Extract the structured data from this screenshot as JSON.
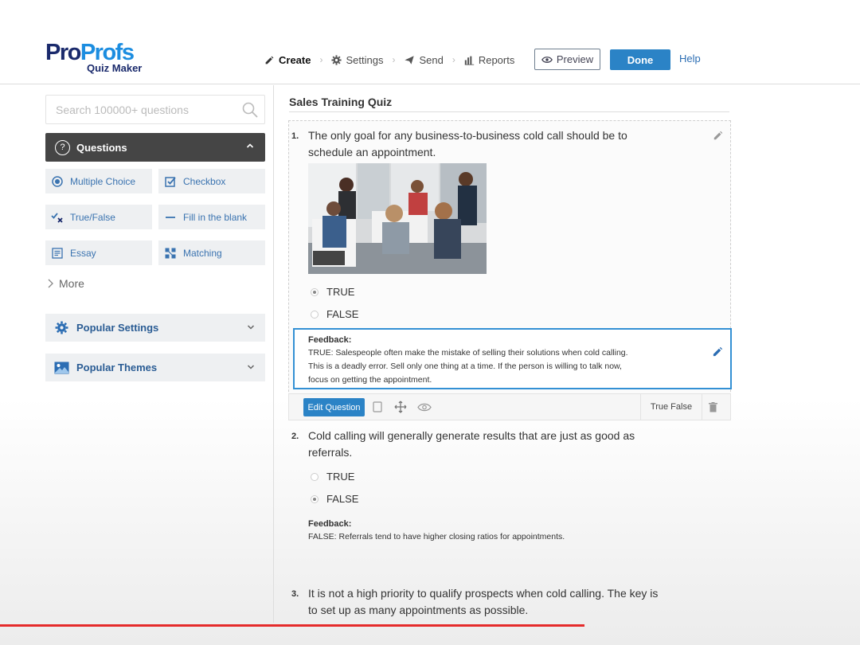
{
  "logo": {
    "part1": "Pro",
    "part2": "Profs",
    "sub": "Quiz Maker"
  },
  "nav": {
    "create": "Create",
    "settings": "Settings",
    "send": "Send",
    "reports": "Reports",
    "preview": "Preview",
    "done": "Done",
    "help": "Help"
  },
  "sidebar": {
    "search_placeholder": "Search 100000+ questions",
    "questions_label": "Questions",
    "types": [
      "Multiple Choice",
      "Checkbox",
      "True/False",
      "Fill in the blank",
      "Essay",
      "Matching"
    ],
    "more": "More",
    "popular_settings": "Popular Settings",
    "popular_themes": "Popular Themes"
  },
  "quiz": {
    "title": "Sales Training Quiz",
    "questions": [
      {
        "num": "1.",
        "text_l1": "The only goal for any business-to-business cold call should be to",
        "text_l2": "schedule an appointment.",
        "options": [
          "TRUE",
          "FALSE"
        ],
        "selected": 0,
        "feedback_title": "Feedback:",
        "feedback_l1": "TRUE: Salespeople often make the mistake of selling their solutions when cold calling.",
        "feedback_l2": "This is a deadly error. Sell only one thing at a time. If the person is willing to talk now,",
        "feedback_l3": "focus on getting the appointment."
      },
      {
        "num": "2.",
        "text_l1": "Cold calling will generally generate results that are just as good as",
        "text_l2": "referrals.",
        "options": [
          "TRUE",
          "FALSE"
        ],
        "selected": 1,
        "feedback_title": "Feedback:",
        "feedback_l1": "FALSE: Referrals tend to have higher closing ratios for appointments."
      },
      {
        "num": "3.",
        "text_l1": "It is not a high priority to qualify prospects when cold calling. The key is",
        "text_l2": "to set up as many appointments as possible."
      }
    ]
  },
  "toolbar": {
    "edit": "Edit Question",
    "type": "True False"
  },
  "video_progress": 0.68,
  "colors": {
    "accent": "#2b83c6",
    "brand_dark": "#1a2a6c",
    "brand_light": "#1c8de0",
    "progress": "#e52b2b"
  }
}
